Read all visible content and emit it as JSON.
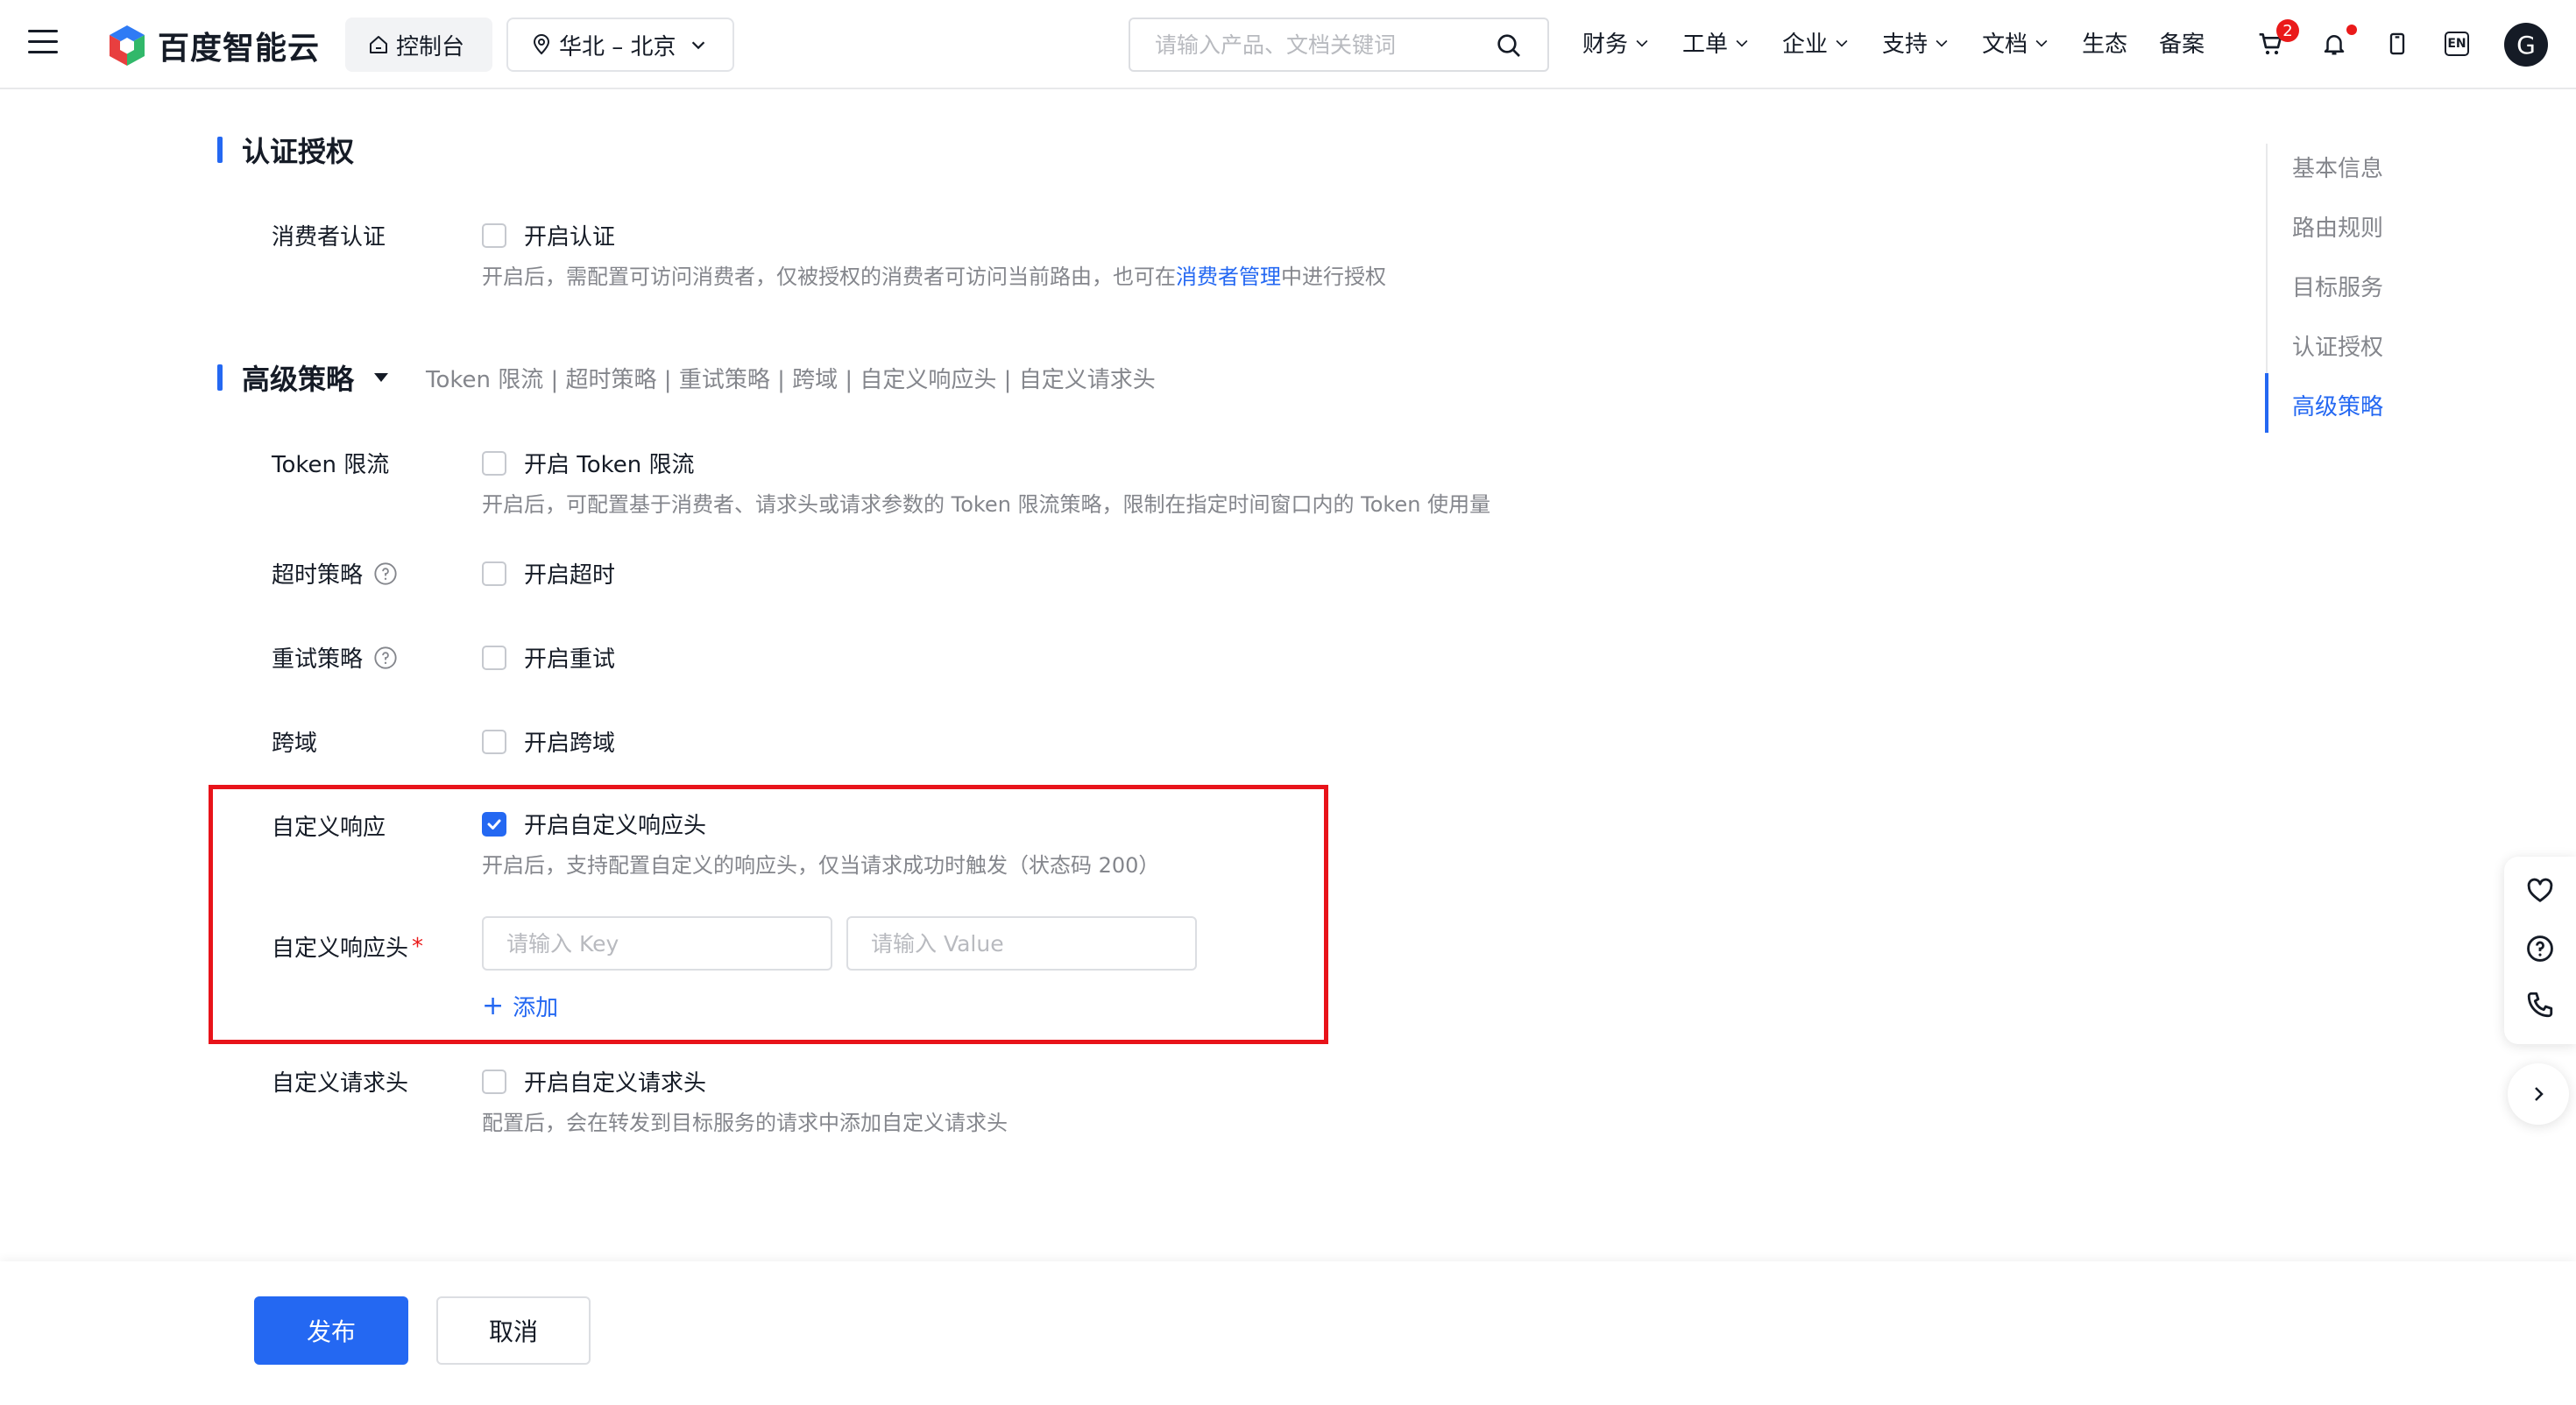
{
  "brand": {
    "name": "百度智能云"
  },
  "header": {
    "console_label": "控制台",
    "region_label": "华北 – 北京",
    "search_placeholder": "请输入产品、文档关键词",
    "menu": [
      {
        "label": "财务",
        "has_dropdown": true
      },
      {
        "label": "工单",
        "has_dropdown": true
      },
      {
        "label": "企业",
        "has_dropdown": true
      },
      {
        "label": "支持",
        "has_dropdown": true
      },
      {
        "label": "文档",
        "has_dropdown": true
      },
      {
        "label": "生态",
        "has_dropdown": false
      },
      {
        "label": "备案",
        "has_dropdown": false
      }
    ],
    "cart_badge": "2",
    "lang_label": "EN",
    "avatar_letter": "G"
  },
  "auth": {
    "title": "认证授权",
    "consumer_label": "消费者认证",
    "consumer_checkbox": "开启认证",
    "consumer_checked": false,
    "hint_before": "开启后，需配置可访问消费者，仅被授权的消费者可访问当前路由，也可在",
    "hint_link": "消费者管理",
    "hint_after": "中进行授权"
  },
  "advanced": {
    "title": "高级策略",
    "subtitle": "Token 限流 | 超时策略 | 重试策略 | 跨域 | 自定义响应头 | 自定义请求头",
    "token_label": "Token 限流",
    "token_checkbox": "开启 Token 限流",
    "token_hint": "开启后，可配置基于消费者、请求头或请求参数的 Token 限流策略，限制在指定时间窗口内的 Token 使用量",
    "timeout_label": "超时策略",
    "timeout_checkbox": "开启超时",
    "retry_label": "重试策略",
    "retry_checkbox": "开启重试",
    "cors_label": "跨域",
    "cors_checkbox": "开启跨域",
    "resp_label": "自定义响应",
    "resp_checkbox": "开启自定义响应头",
    "resp_checked": true,
    "resp_hint": "开启后，支持配置自定义的响应头，仅当请求成功时触发（状态码 200）",
    "resp_headers_label": "自定义响应头",
    "required_mark": "*",
    "key_placeholder": "请输入 Key",
    "value_placeholder": "请输入 Value",
    "add_label": "添加",
    "req_label": "自定义请求头",
    "req_checkbox": "开启自定义请求头",
    "req_hint": "配置后，会在转发到目标服务的请求中添加自定义请求头"
  },
  "anchor_nav": {
    "items": [
      "基本信息",
      "路由规则",
      "目标服务",
      "认证授权",
      "高级策略"
    ],
    "active": "高级策略"
  },
  "footer": {
    "publish_label": "发布",
    "cancel_label": "取消"
  },
  "colors": {
    "primary": "#2468f2",
    "highlight_border": "#e8131a",
    "text": "#151b26",
    "muted": "#84868c"
  }
}
